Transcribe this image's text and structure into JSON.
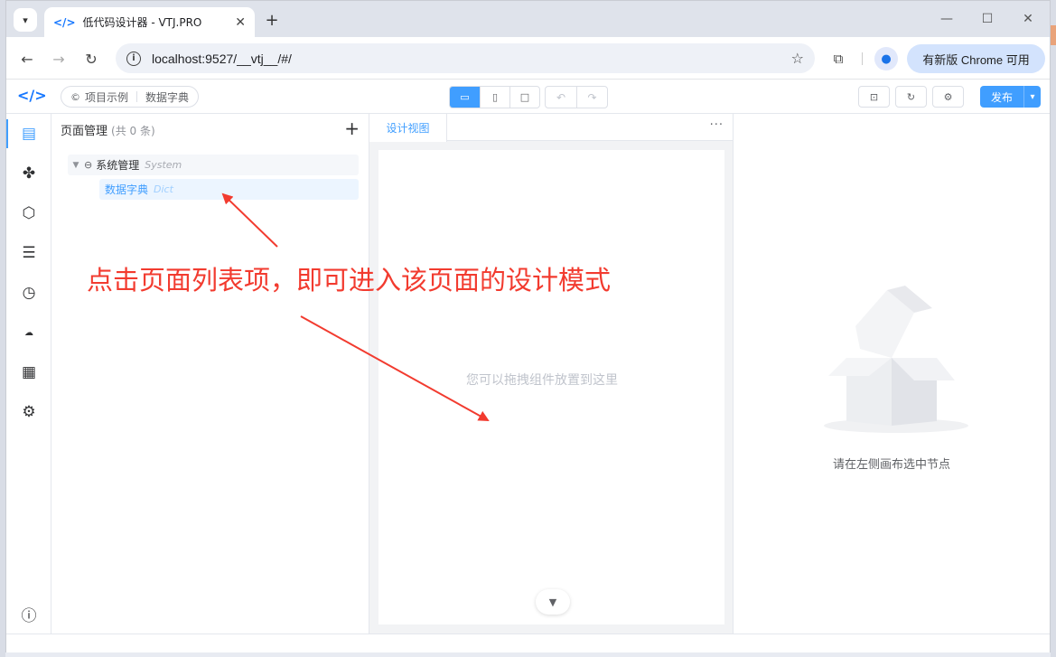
{
  "browser": {
    "tab_title": "低代码设计器 - VTJ.PRO",
    "url": "localhost:9527/__vtj__/#/",
    "update_label": "有新版 Chrome 可用"
  },
  "header": {
    "back_label": "项目示例",
    "current_page": "数据字典",
    "publish_label": "发布"
  },
  "pages_panel": {
    "title": "页面管理",
    "count": "(共 0 条)",
    "tree": [
      {
        "label": "系统管理",
        "sub": "System"
      },
      {
        "label": "数据字典",
        "sub": "Dict"
      }
    ]
  },
  "design": {
    "tab_label": "设计视图",
    "more": "···",
    "hint": "您可以拖拽组件放置到这里"
  },
  "props": {
    "empty_text": "请在左侧画布选中节点"
  },
  "annotation": {
    "text": "点击页面列表项，即可进入该页面的设计模式",
    "color": "#f23b2f"
  },
  "colors": {
    "accent": "#409eff"
  }
}
